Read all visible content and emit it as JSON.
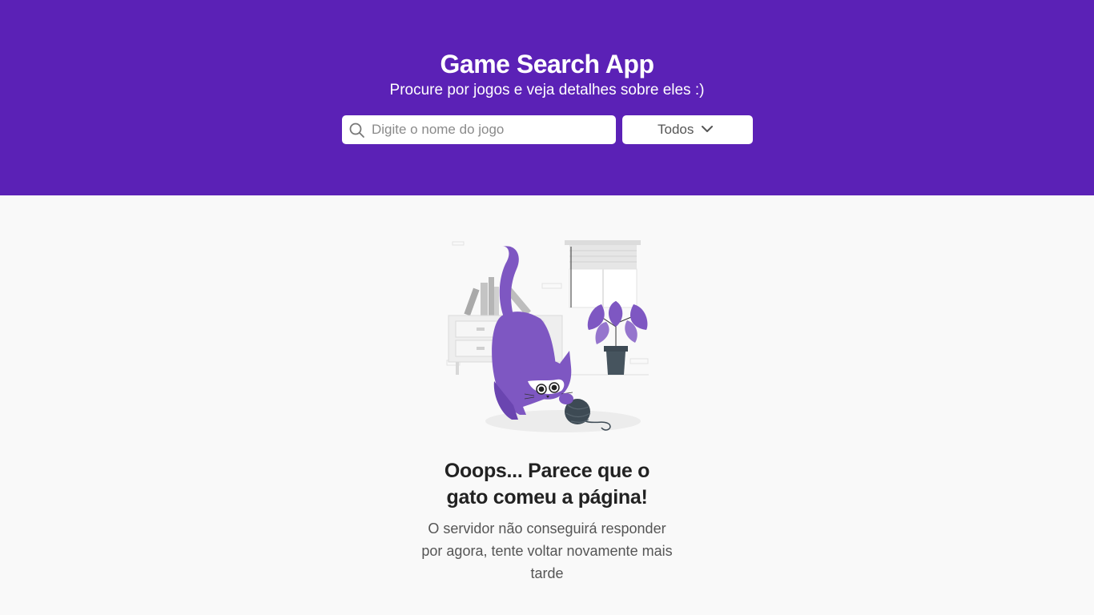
{
  "header": {
    "title": "Game Search App",
    "subtitle": "Procure por jogos e veja detalhes sobre eles :)",
    "search": {
      "placeholder": "Digite o nome do jogo",
      "value": "",
      "icon": "search-icon"
    },
    "filter": {
      "selected": "Todos",
      "icon": "chevron-down-icon"
    }
  },
  "error": {
    "illustration": "cat-playing-with-yarn-illustration",
    "title": "Ooops... Parece que o gato comeu a página!",
    "message": "O servidor não conseguirá responder por agora, tente voltar novamente mais tarde"
  },
  "colors": {
    "brand": "#5b21b6",
    "cat": "#7e57c2",
    "background": "#f9f9f9"
  }
}
